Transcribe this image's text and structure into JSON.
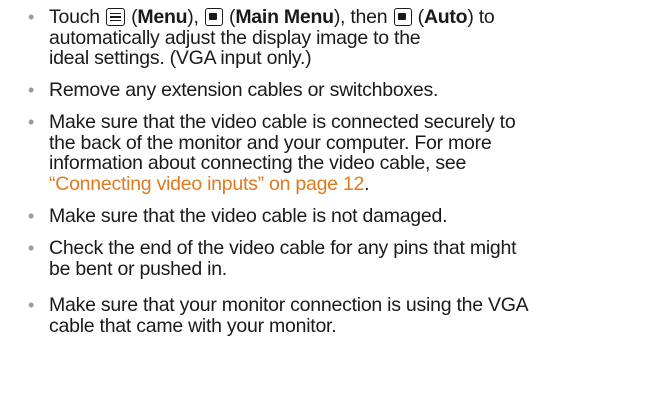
{
  "bullets": [
    {
      "marker": "•",
      "lines": [
        {
          "t1": "Touch ",
          "b1": "Menu",
          "t2": "), ",
          "b2": "Main Menu",
          "t3": "), then ",
          "b3": "Auto",
          "t4": ") to"
        },
        {
          "text": "automatically adjust the display image to the"
        },
        {
          "text": "ideal settings. (VGA input only.)"
        }
      ],
      "icons": [
        "menu-icon",
        "main-menu-icon",
        "auto-icon"
      ]
    },
    {
      "marker": "•",
      "lines": [
        {
          "text": "Remove any extension cables or switchboxes."
        }
      ]
    },
    {
      "marker": "•",
      "lines": [
        {
          "text": "Make sure that the video cable is connected securely to"
        },
        {
          "text": "the back of the monitor and your computer. For more"
        },
        {
          "text": "information about connecting the video cable, see"
        },
        {
          "link": "“Connecting video inputs” on page 12",
          "after": "."
        }
      ]
    },
    {
      "marker": "•",
      "lines": [
        {
          "text": "Make sure that the video cable is not damaged."
        }
      ]
    },
    {
      "marker": "•",
      "lines": [
        {
          "text": "Check the end of the video cable for any pins that might"
        },
        {
          "text": "be bent or pushed in."
        }
      ]
    },
    {
      "marker": "•",
      "lines": [
        {
          "text": "Make sure that your monitor connection is using the VGA"
        },
        {
          "text": "cable that came with your monitor."
        }
      ]
    }
  ],
  "colors": {
    "text": "#1a1a1a",
    "bullet": "#9a9a9a",
    "link": "#e07a1f"
  }
}
